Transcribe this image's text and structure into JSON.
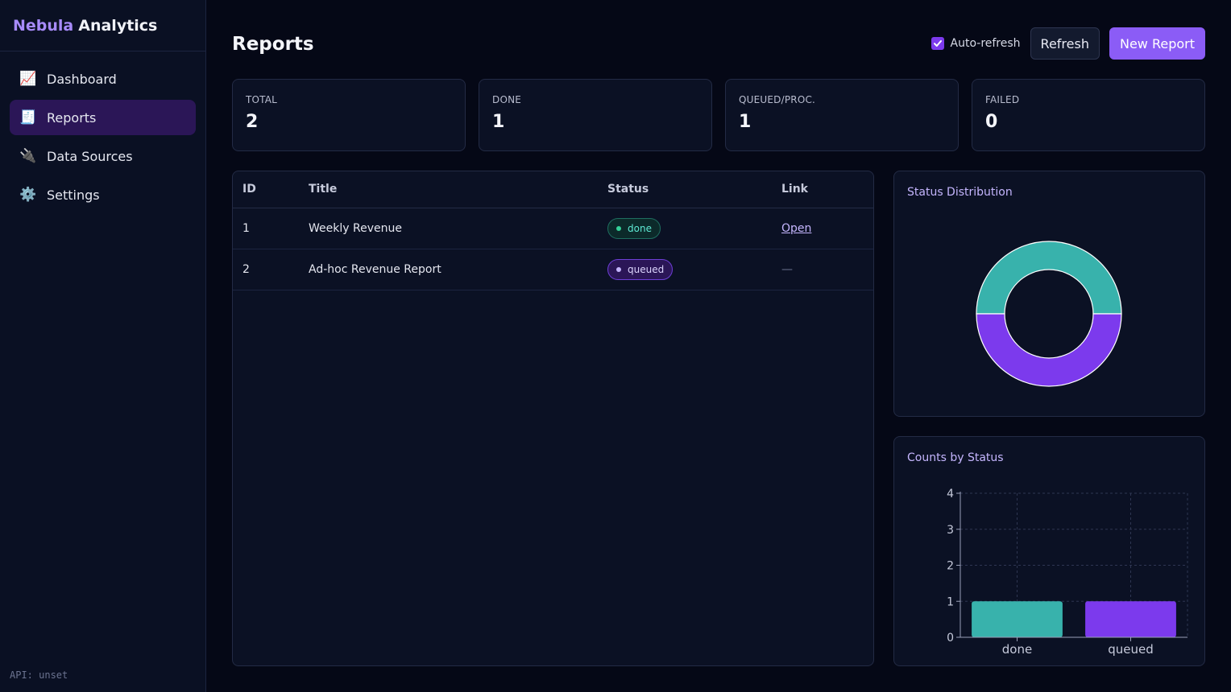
{
  "brand": {
    "part1": "Nebula",
    "part2": "Analytics"
  },
  "sidebar": {
    "items": [
      {
        "label": "Dashboard",
        "icon": "chart-increasing-icon",
        "glyph": "📈",
        "active": false
      },
      {
        "label": "Reports",
        "icon": "receipt-icon",
        "glyph": "🧾",
        "active": true
      },
      {
        "label": "Data Sources",
        "icon": "plug-icon",
        "glyph": "🔌",
        "active": false
      },
      {
        "label": "Settings",
        "icon": "gear-icon",
        "glyph": "⚙️",
        "active": false
      }
    ],
    "api_status": "API: unset"
  },
  "header": {
    "title": "Reports",
    "autorefresh_label": "Auto-refresh",
    "autorefresh_checked": true,
    "refresh_label": "Refresh",
    "new_report_label": "New Report"
  },
  "stats": [
    {
      "label": "TOTAL",
      "value": "2"
    },
    {
      "label": "DONE",
      "value": "1"
    },
    {
      "label": "QUEUED/PROC.",
      "value": "1"
    },
    {
      "label": "FAILED",
      "value": "0"
    }
  ],
  "table": {
    "columns": [
      "ID",
      "Title",
      "Status",
      "Link"
    ],
    "rows": [
      {
        "id": "1",
        "title": "Weekly Revenue",
        "status": "done",
        "link": "Open"
      },
      {
        "id": "2",
        "title": "Ad-hoc Revenue Report",
        "status": "queued",
        "link": "—"
      }
    ]
  },
  "colors": {
    "accent": "#8b5cf6",
    "done": "#38b2ac",
    "queued": "#7c3aed"
  },
  "chart_data": [
    {
      "type": "pie",
      "title": "Status Distribution",
      "categories": [
        "done",
        "queued"
      ],
      "values": [
        1,
        1
      ],
      "donut": true
    },
    {
      "type": "bar",
      "title": "Counts by Status",
      "categories": [
        "done",
        "queued"
      ],
      "values": [
        1,
        1
      ],
      "ylim": [
        0,
        4
      ],
      "yticks": [
        "0",
        "1",
        "2",
        "3",
        "4"
      ],
      "grid": true
    }
  ]
}
